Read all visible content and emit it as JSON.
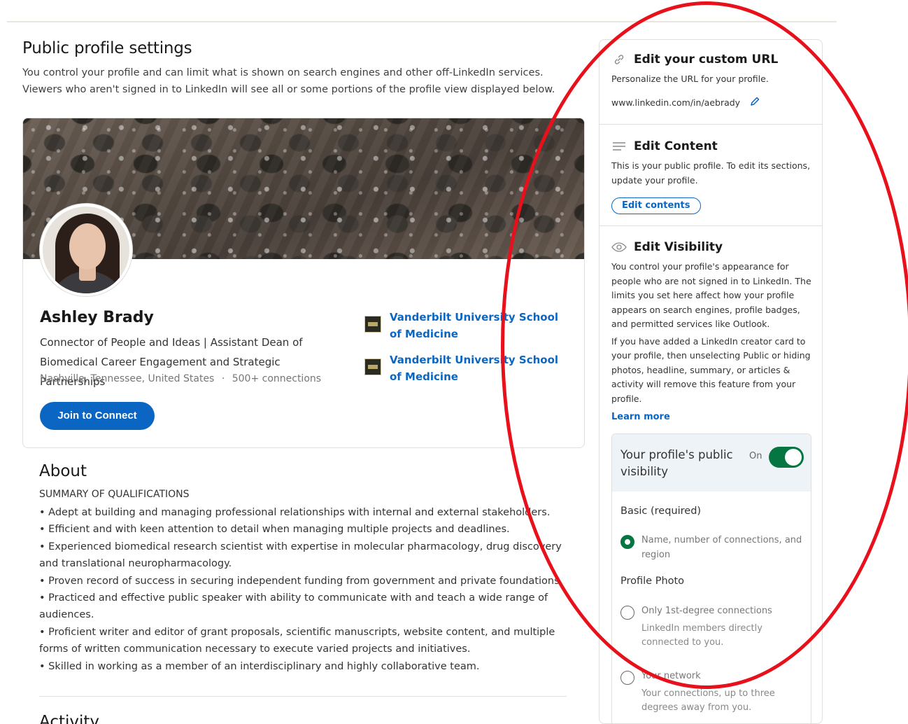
{
  "page": {
    "title": "Public profile settings",
    "description": "You control your profile and can limit what is shown on search engines and other off-LinkedIn services. Viewers who aren't signed in to LinkedIn will see all or some portions of the profile view displayed below."
  },
  "profile": {
    "name": "Ashley Brady",
    "headline": "Connector of People and Ideas | Assistant Dean of Biomedical Career Engagement and Strategic Partnerships",
    "location": "Nashville, Tennessee, United States",
    "separator": "·",
    "connections": "500+ connections",
    "join_button": "Join to Connect",
    "education": [
      {
        "name": "Vanderbilt University School of Medicine"
      },
      {
        "name": "Vanderbilt University School of Medicine"
      }
    ]
  },
  "about": {
    "heading": "About",
    "summary_title": "SUMMARY OF QUALIFICATIONS",
    "bullets": [
      "• Adept at building and managing professional relationships with internal and external stakeholders.",
      "• Efficient and with keen attention to detail when managing multiple projects and deadlines.",
      "• Experienced biomedical research scientist with expertise in molecular pharmacology, drug discovery and translational neuropharmacology.",
      "• Proven record of success in securing independent funding from government and private foundations.",
      "• Practiced and effective public speaker with ability to communicate with and teach a wide range of audiences.",
      "• Proficient writer and editor of grant proposals, scientific manuscripts, website content, and multiple forms of written communication necessary to execute varied projects and initiatives.",
      "• Skilled in working as a member of an interdisciplinary and highly collaborative team."
    ],
    "activity_heading": "Activity"
  },
  "sidebar": {
    "custom_url": {
      "title": "Edit your custom URL",
      "text": "Personalize the URL for your profile.",
      "url": "www.linkedin.com/in/aebrady"
    },
    "content": {
      "title": "Edit Content",
      "text": "This is your public profile. To edit its sections, update your profile.",
      "button": "Edit contents"
    },
    "visibility": {
      "title": "Edit Visibility",
      "text1": "You control your profile's appearance for people who are not signed in to LinkedIn. The limits you set here affect how your profile appears on search engines, profile badges, and permitted services like Outlook.",
      "text2": "If you have added a LinkedIn creator card to your profile, then unselecting Public or hiding photos, headline, summary, or articles & activity will remove this feature from your profile.",
      "learn_more": "Learn more"
    },
    "public_visibility": {
      "title": "Your profile's public visibility",
      "state_label": "On",
      "enabled": true,
      "basic_label": "Basic (required)",
      "basic_option": "Name, number of connections, and region",
      "photo_label": "Profile Photo",
      "photo_options": [
        {
          "label": "Only 1st-degree connections",
          "sub": "LinkedIn members directly connected to you."
        },
        {
          "label": "Your network",
          "sub": "Your connections, up to three degrees away from you."
        }
      ]
    }
  },
  "colors": {
    "accent": "#0a66c2",
    "toggle_on": "#057642",
    "annotation": "#e8101a"
  },
  "icons": {
    "link": "link-icon",
    "lines": "lines-icon",
    "eye": "eye-icon",
    "pencil": "pencil-icon"
  }
}
